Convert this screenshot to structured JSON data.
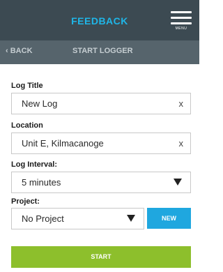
{
  "header": {
    "title": "FEEDBACK",
    "menu_label": "MENU"
  },
  "subheader": {
    "back_label": "BACK",
    "title": "START LOGGER"
  },
  "form": {
    "log_title": {
      "label": "Log Title",
      "value": "New Log",
      "clear": "x"
    },
    "location": {
      "label": "Location",
      "value": "Unit E, Kilmacanoge",
      "clear": "x"
    },
    "log_interval": {
      "label": "Log Interval:",
      "value": "5 minutes"
    },
    "project": {
      "label": "Project:",
      "value": "No Project",
      "new_label": "NEW"
    }
  },
  "actions": {
    "start_label": "START"
  },
  "colors": {
    "header_bg": "#3c4a52",
    "subheader_bg": "#56646c",
    "accent": "#1fa7df",
    "start": "#8dbf2c"
  }
}
